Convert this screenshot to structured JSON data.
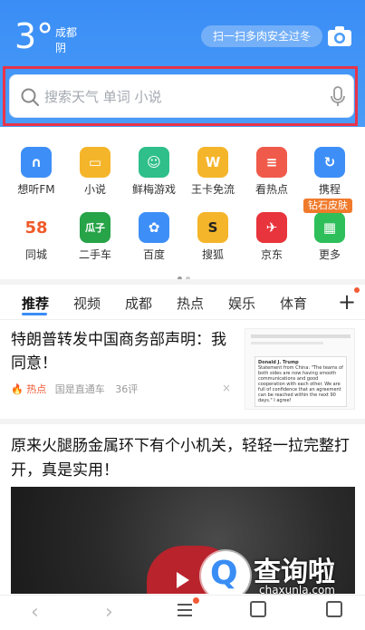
{
  "weather": {
    "temp": "3°",
    "city": "成都",
    "condition": "阴"
  },
  "header": {
    "scan_label": "扫一扫多肉安全过冬",
    "camera_icon": "camera-icon"
  },
  "search": {
    "placeholder": "搜索天气 单词 小说",
    "icon": "search-icon",
    "mic_icon": "mic-icon"
  },
  "apps": [
    {
      "label": "想听FM",
      "icon": "headphones-icon",
      "glyph": "∩",
      "color": "#3d8ff7"
    },
    {
      "label": "小说",
      "icon": "book-icon",
      "glyph": "▭",
      "color": "#f5b52a"
    },
    {
      "label": "鲜梅游戏",
      "icon": "game-icon",
      "glyph": "☺",
      "color": "#2ebf8a"
    },
    {
      "label": "王卡免流",
      "icon": "wangka-icon",
      "glyph": "W",
      "color": "#f5b52a"
    },
    {
      "label": "看热点",
      "icon": "hotspot-icon",
      "glyph": "≡",
      "color": "#f05a4a"
    },
    {
      "label": "携程",
      "icon": "ctrip-icon",
      "glyph": "↻",
      "color": "#3d8ff7"
    },
    {
      "label": "同城",
      "icon": "58-icon",
      "glyph": "58",
      "color": "#ffffff"
    },
    {
      "label": "二手车",
      "icon": "guazi-icon",
      "glyph": "瓜子",
      "color": "#27a348"
    },
    {
      "label": "百度",
      "icon": "baidu-icon",
      "glyph": "✿",
      "color": "#3d8ff7"
    },
    {
      "label": "搜狐",
      "icon": "sohu-icon",
      "glyph": "S",
      "color": "#f5b52a"
    },
    {
      "label": "京东",
      "icon": "jd-icon",
      "glyph": "✈",
      "color": "#e8343c"
    },
    {
      "label": "更多",
      "icon": "grid-icon",
      "glyph": "▦",
      "color": "#2ebf5a"
    }
  ],
  "badge": "钻石皮肤",
  "tabs": [
    "推荐",
    "视频",
    "成都",
    "热点",
    "娱乐",
    "体育"
  ],
  "tab_plus": "+",
  "news": [
    {
      "title": "特朗普转发中国商务部声明：我同意！",
      "tag": "热点",
      "source": "国是直通车",
      "comments": "36评",
      "close": "×"
    },
    {
      "title": "原来火腿肠金属环下有个小机关，轻轻一拉完整打开，真是实用！"
    }
  ],
  "thumb1": {
    "account": "Donald J. Trump",
    "text": "Statement from China: \"The teams of both sides are now having smooth communications and good cooperation with each other. We are full of confidence that an agreement can be reached within the next 90 days.\" I agree!"
  },
  "watermark": {
    "brand": "查询啦",
    "url": "chaxunla.com"
  },
  "bottom_nav": {
    "back": "‹",
    "forward": "›"
  }
}
